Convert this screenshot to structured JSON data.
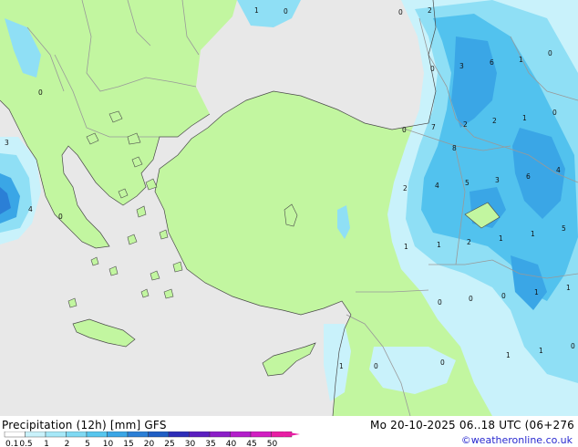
{
  "map": {
    "colors": {
      "sea": "#e8e8e8",
      "land": "#c2f6a0",
      "border": "#999999",
      "coast": "#4a4a4a",
      "precip_1": "#c9f2fb",
      "precip_2": "#8fdff5",
      "precip_3": "#52c2ee",
      "precip_4": "#3aa6e6",
      "precip_5": "#2b7fd6"
    },
    "value_labels": [
      "1",
      "0",
      "0",
      "2",
      "0",
      "3",
      "6",
      "1",
      "0",
      "7",
      "2",
      "2",
      "1",
      "0",
      "0",
      "8",
      "2",
      "4",
      "5",
      "3",
      "6",
      "4",
      "3",
      "4",
      "0",
      "1",
      "1",
      "2",
      "1",
      "1",
      "5",
      "1",
      "0",
      "0",
      "1",
      "0",
      "0",
      "1",
      "1",
      "0"
    ]
  },
  "footer": {
    "title": "Precipitation (12h) [mm] GFS",
    "validity": "Mo 20-10-2025 06..18 UTC (06+276",
    "credit": "©weatheronline.co.uk"
  },
  "legend": {
    "ticks": [
      "0.1",
      "0.5",
      "1",
      "2",
      "5",
      "10",
      "15",
      "20",
      "25",
      "30",
      "35",
      "40",
      "45",
      "50"
    ],
    "colors": [
      "#ffffff",
      "#c9f2fb",
      "#a6e8f8",
      "#7fd9f3",
      "#57c6ee",
      "#3aa6e6",
      "#2b7fd6",
      "#1f5ec4",
      "#2d2db8",
      "#5b1fc0",
      "#8c1ec8",
      "#b41ecb",
      "#d21ec2",
      "#e81ea4"
    ]
  }
}
